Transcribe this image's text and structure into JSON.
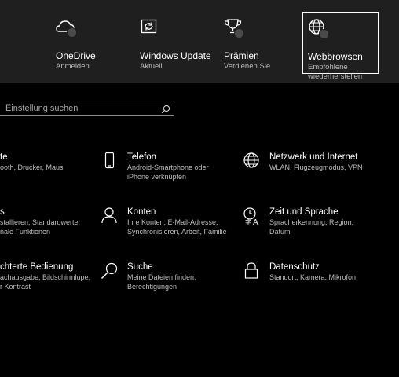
{
  "top_tiles": [
    {
      "title": "OneDrive",
      "subtitle": "Anmelden",
      "icon": "onedrive-cloud-icon"
    },
    {
      "title": "Windows Update",
      "subtitle": "Aktuell",
      "icon": "windows-update-sync-icon"
    },
    {
      "title": "Prämien",
      "subtitle": "Verdienen Sie",
      "icon": "rewards-trophy-icon"
    },
    {
      "title": "Webbrowsen",
      "subtitle": "Empfohlene wiederherstellen",
      "subtitle_line1": "Empfohlene",
      "subtitle_line2": "wiederherstellen",
      "icon": "web-browsing-globe-icon"
    }
  ],
  "search": {
    "placeholder": "Einstellung suchen",
    "icon": "search-icon"
  },
  "categories": [
    {
      "title": "Geräte",
      "visible_title": "te",
      "line1": "ooth, Drucker, Maus",
      "icon": "devices-icon"
    },
    {
      "title": "Telefon",
      "line1": "Android-Smartphone oder",
      "line2": "iPhone verknüpfen",
      "icon": "phone-icon"
    },
    {
      "title": "Netzwerk und Internet",
      "line1": "WLAN, Flugzeugmodus, VPN",
      "icon": "network-globe-icon"
    },
    {
      "title": "Apps",
      "visible_title": "s",
      "line1": "stallieren, Standardwerte,",
      "line2": "nale Funktionen",
      "icon": "apps-icon"
    },
    {
      "title": "Konten",
      "line1": "Ihre Konten, E-Mail-Adresse,",
      "line2": "Synchronisieren, Arbeit, Familie",
      "icon": "accounts-person-icon"
    },
    {
      "title": "Zeit und Sprache",
      "line1": "Spracherkennung, Region,",
      "line2": "Datum",
      "icon": "time-language-icon"
    },
    {
      "title": "Erleichterte Bedienung",
      "visible_title": "chterte Bedienung",
      "line1": "achausgabe, Bildschirmlupe,",
      "line2": "r Kontrast",
      "icon": "ease-of-access-icon"
    },
    {
      "title": "Suche",
      "line1": "Meine Dateien finden,",
      "line2": "Berechtigungen",
      "icon": "search-category-icon"
    },
    {
      "title": "Datenschutz",
      "line1": "Standort, Kamera, Mikrofon",
      "icon": "privacy-lock-icon"
    }
  ]
}
